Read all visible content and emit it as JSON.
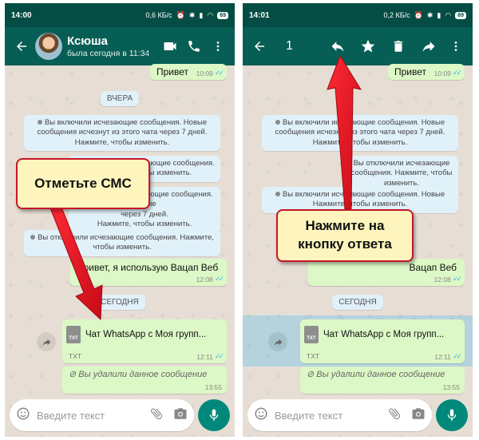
{
  "screen1": {
    "status": {
      "time": "14:00",
      "speed": "0,6 КБ/с",
      "battery": "69"
    },
    "header": {
      "name": "Ксюша",
      "last_seen": "была сегодня в 11:34"
    },
    "messages": {
      "hello": {
        "text": "Привет",
        "time": "10:09"
      },
      "day_yesterday": "ВЧЕРА",
      "sys1": "Вы включили исчезающие сообщения. Новые сообщения исчезнут из этого чата через 7 дней. Нажмите, чтобы изменить.",
      "sys2": "Вы отключили исчезающие сообщения. Нажмите, чтобы изменить.",
      "sys3_top": "Вы включили исчезающие сообщения. Новые",
      "sys3_mid": "через 7 дней.",
      "sys3_bot": "Нажмите, чтобы изменить.",
      "sys4": "Вы отключили исчезающие сообщения. Нажмите, чтобы изменить.",
      "webapp": {
        "text": "Привет, я использую Вацап Веб",
        "time": "12:08"
      },
      "day_today": "СЕГОДНЯ",
      "file": {
        "name": "Чат WhatsApp с Моя групп...",
        "type": "TXT",
        "time": "12:11",
        "icon_label": "TXT"
      },
      "deleted": {
        "text": "Вы удалили данное сообщение",
        "time": "13:55"
      }
    },
    "input_placeholder": "Введите текст",
    "callout": "Отметьте СМС"
  },
  "screen2": {
    "status": {
      "time": "14:01",
      "speed": "0,2 КБ/с",
      "battery": "69"
    },
    "header": {
      "selected_count": "1"
    },
    "messages": {
      "hello": {
        "text": "Привет",
        "time": "10:09"
      },
      "sys1": "Вы включили исчезающие сообщения. Новые сообщения исчезнут из этого чата через 7 дней. Нажмите, чтобы изменить.",
      "sys2": "Вы отключили исчезающие сообщения. Нажмите, чтобы изменить.",
      "sys3_top": "Вы включили исчезающие сообщения. Новые",
      "sys3_bot": "Нажмите, чтобы изменить.",
      "webapp": {
        "text": "Вацап Веб",
        "time": "12:08"
      },
      "day_today": "СЕГОДНЯ",
      "file": {
        "name": "Чат WhatsApp с Моя групп...",
        "type": "TXT",
        "time": "12:11",
        "icon_label": "TXT"
      },
      "deleted": {
        "text": "Вы удалили данное сообщение",
        "time": "13:55"
      }
    },
    "input_placeholder": "Введите текст",
    "callout": "Нажмите на кнопку ответа"
  },
  "colors": {
    "header": "#075e54",
    "statusbar": "#054d44",
    "outgoing": "#dcf8c6",
    "system": "#e1f1fa",
    "mic": "#00897b",
    "arrow": "#e3101f",
    "callout_bg": "#fdf5bd",
    "ticks": "#34b7f1"
  },
  "icons": [
    "back-arrow-icon",
    "video-call-icon",
    "phone-icon",
    "more-vert-icon",
    "reply-icon",
    "star-icon",
    "delete-icon",
    "forward-icon",
    "emoji-icon",
    "attach-icon",
    "camera-icon",
    "mic-icon",
    "double-check-icon",
    "ban-icon",
    "file-icon"
  ]
}
